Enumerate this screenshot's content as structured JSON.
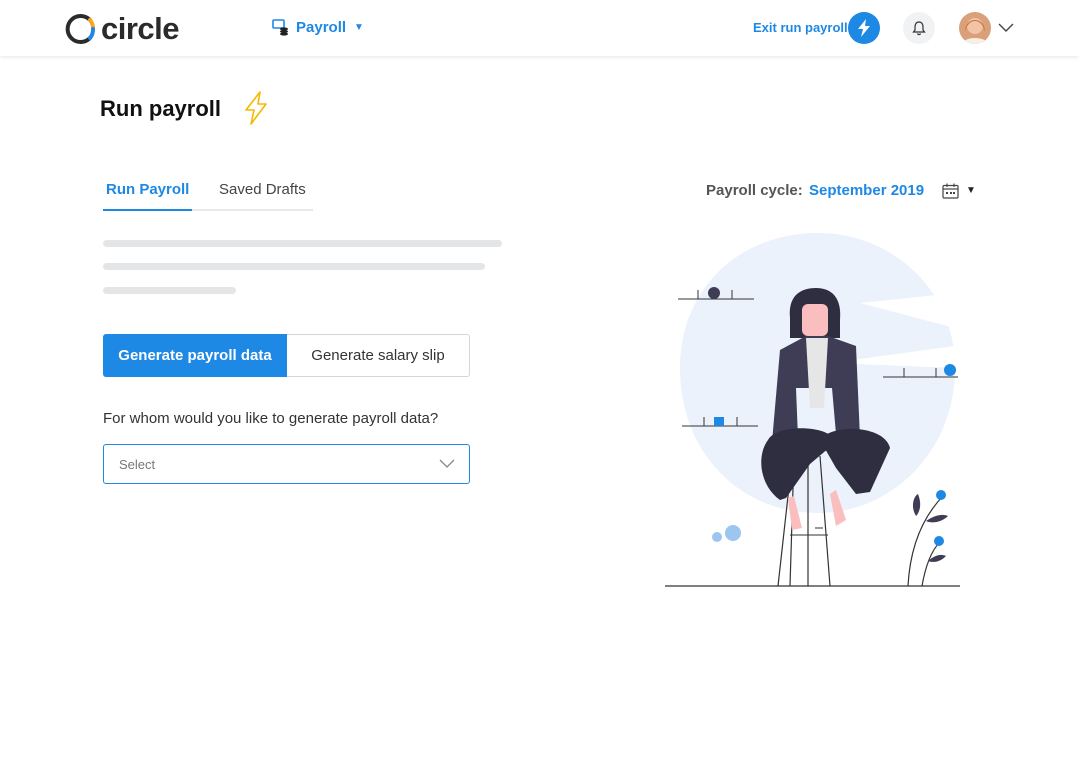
{
  "brand": {
    "logo_text": "circle",
    "logo_icon": "circle-c-logo-icon"
  },
  "header": {
    "module_label": "Payroll",
    "module_icon": "payroll-stack-icon",
    "exit_label": "Exit run payroll",
    "exit_icon": "lightning-icon",
    "notification_icon": "bell-icon",
    "user_menu_icon": "chevron-down-icon"
  },
  "page": {
    "title": "Run payroll",
    "title_icon": "lightning-icon"
  },
  "tabs": [
    {
      "label": "Run Payroll",
      "active": true
    },
    {
      "label": "Saved Drafts",
      "active": false
    }
  ],
  "actions": {
    "primary_label": "Generate payroll data",
    "secondary_label": "Generate salary slip"
  },
  "form": {
    "question": "For whom would you like to generate payroll data?",
    "select_placeholder": "Select"
  },
  "payroll_cycle": {
    "label": "Payroll cycle:",
    "value": "September 2019",
    "icon": "calendar-icon"
  },
  "colors": {
    "accent": "#1e88e5",
    "bolt_yellow": "#f5b800",
    "skeleton": "#e4e5e7"
  }
}
